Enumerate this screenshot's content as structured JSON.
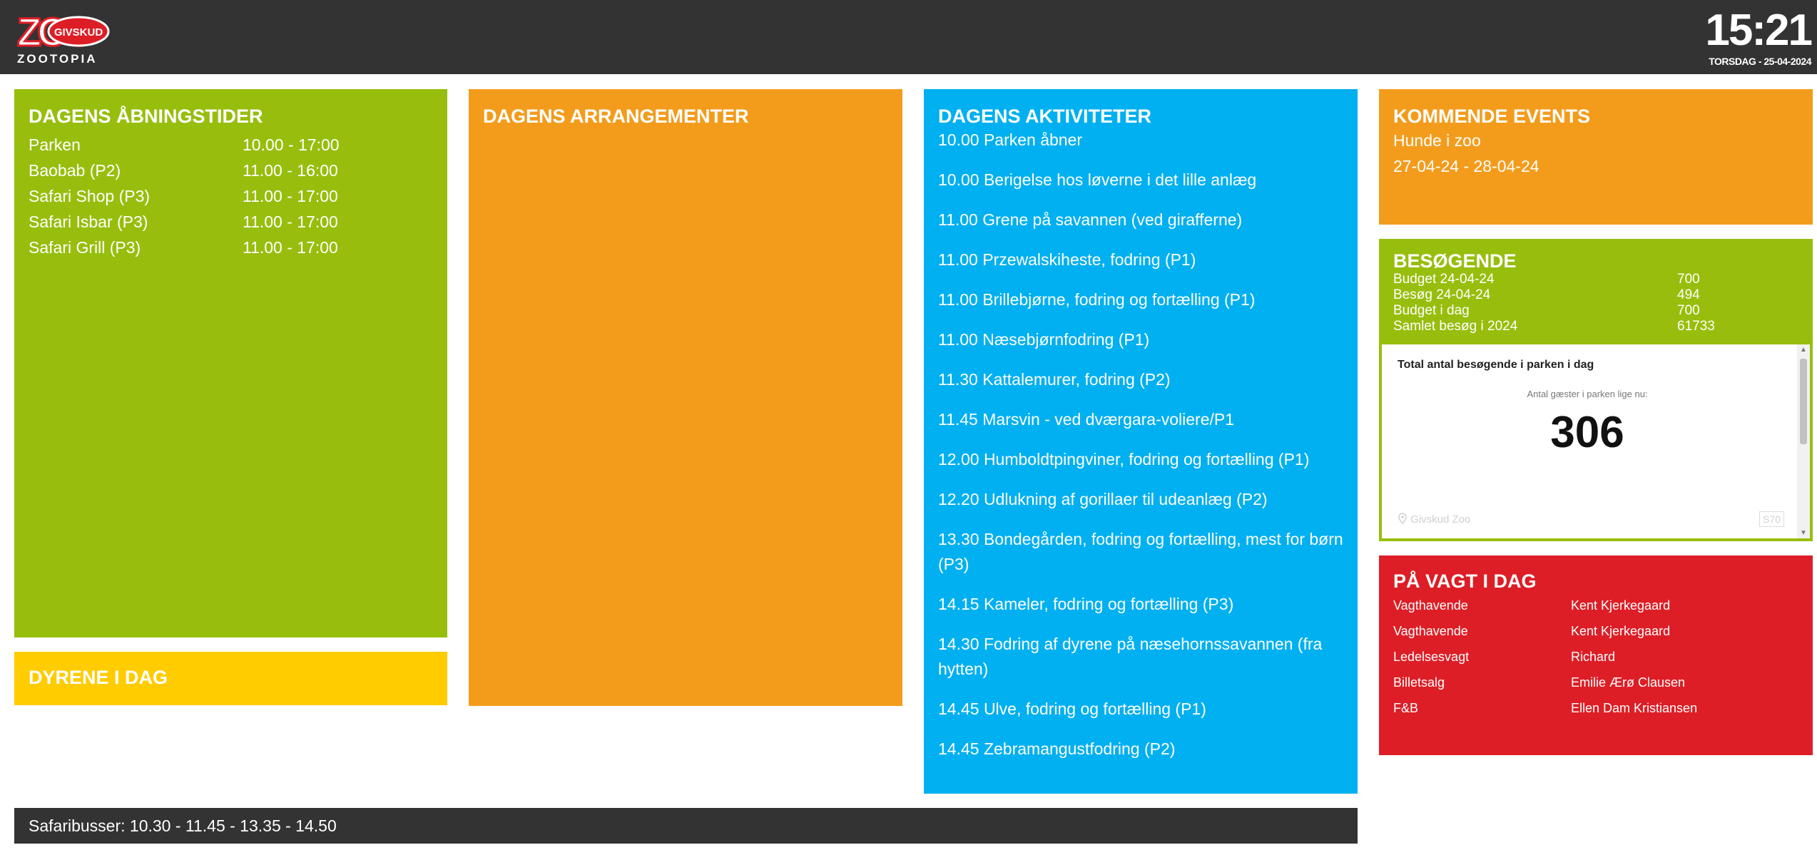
{
  "header": {
    "logo": {
      "brand": "ZOO",
      "badge": "GIVSKUD",
      "sub": "ZOOTOPIA"
    },
    "clock": {
      "time": "15:21",
      "date": "TORSDAG - 25-04-2024"
    }
  },
  "opening_hours": {
    "title": "DAGENS ÅBNINGSTIDER",
    "rows": [
      {
        "place": "Parken",
        "hours": "10.00 - 17:00"
      },
      {
        "place": "Baobab (P2)",
        "hours": "11.00 - 16:00"
      },
      {
        "place": "Safari Shop (P3)",
        "hours": "11.00 - 17:00"
      },
      {
        "place": "Safari Isbar (P3)",
        "hours": "11.00 - 17:00"
      },
      {
        "place": "Safari Grill (P3)",
        "hours": "11.00 - 17:00"
      }
    ]
  },
  "animals_today": {
    "title": "DYRENE I DAG"
  },
  "arrangements": {
    "title": "DAGENS ARRANGEMENTER"
  },
  "activities": {
    "title": "DAGENS AKTIVITETER",
    "items": [
      "10.00 Parken åbner",
      "10.00 Berigelse hos løverne i det lille anlæg",
      "11.00 Grene på savannen (ved girafferne)",
      "11.00 Przewalskiheste, fodring (P1)",
      "11.00 Brillebjørne, fodring og fortælling (P1)",
      "11.00 Næsebjørnfodring (P1)",
      "11.30 Kattalemurer, fodring (P2)",
      "11.45 Marsvin - ved dværgara-voliere/P1",
      "12.00 Humboldtpingviner, fodring og fortælling (P1)",
      "12.20 Udlukning af gorillaer til udeanlæg (P2)",
      "13.30 Bondegården, fodring og fortælling, mest for børn (P3)",
      "14.15 Kameler, fodring og fortælling (P3)",
      "14.30 Fodring af dyrene på næsehornssavannen (fra hytten)",
      "14.45 Ulve, fodring og fortælling (P1)",
      "14.45 Zebramangustfodring (P2)"
    ]
  },
  "upcoming": {
    "title": "KOMMENDE EVENTS",
    "event_name": "Hunde i zoo",
    "event_dates": "27-04-24 - 28-04-24"
  },
  "visitors": {
    "title": "BESØGENDE",
    "rows": [
      {
        "label": "Budget 24-04-24",
        "value": "700"
      },
      {
        "label": "Besøg 24-04-24",
        "value": "494"
      },
      {
        "label": "Budget i dag",
        "value": "700"
      },
      {
        "label": "Samlet besøg i 2024",
        "value": "61733"
      }
    ],
    "widget": {
      "title": "Total antal besøgende i parken i dag",
      "subtitle": "Antal gæster i parken lige nu:",
      "count": "306",
      "location": "Givskud Zoo",
      "badge": "S70"
    }
  },
  "on_duty": {
    "title": "PÅ VAGT I DAG",
    "rows": [
      {
        "role": "Vagthavende",
        "name": "Kent Kjerkegaard"
      },
      {
        "role": "Vagthavende",
        "name": "Kent Kjerkegaard"
      },
      {
        "role": "Ledelsesvagt",
        "name": "Richard"
      },
      {
        "role": "Billetsalg",
        "name": "Emilie Ærø Clausen"
      },
      {
        "role": "F&B",
        "name": "Ellen Dam Kristiansen"
      }
    ]
  },
  "footer": {
    "text": "Safaribusser: 10.30 - 11.45 - 13.35 - 14.50"
  },
  "colors": {
    "green": "#97be0d",
    "yellow": "#ffcc00",
    "orange": "#f39c1c",
    "blue": "#00b0f0",
    "red": "#dd1e26",
    "dark": "#333333"
  }
}
